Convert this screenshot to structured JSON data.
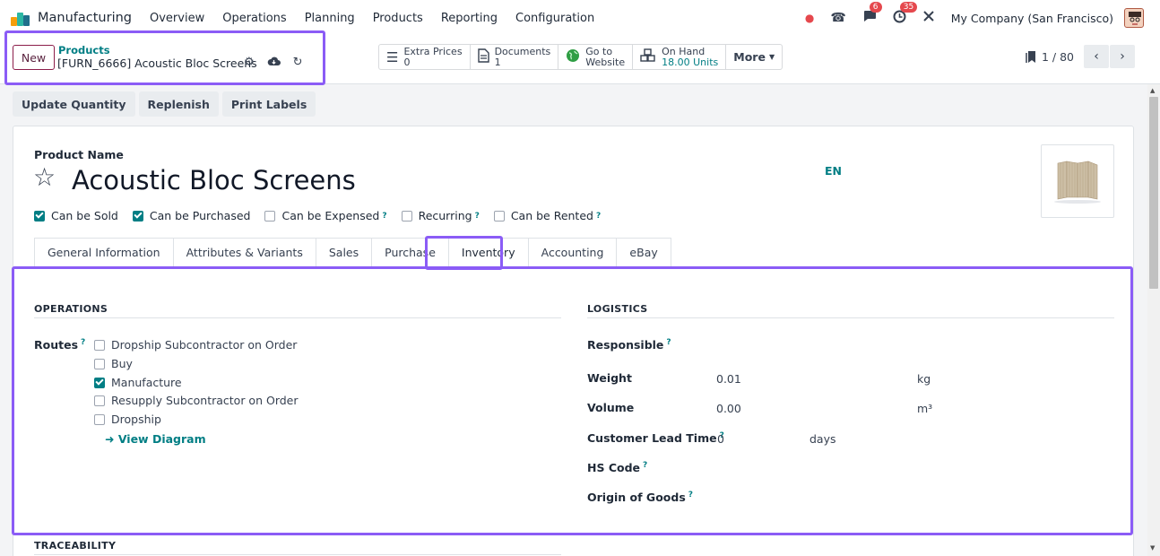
{
  "navbar": {
    "app_name": "Manufacturing",
    "menu": [
      "Overview",
      "Operations",
      "Planning",
      "Products",
      "Reporting",
      "Configuration"
    ],
    "messages_badge": "6",
    "activities_badge": "35",
    "company": "My Company (San Francisco)"
  },
  "control_panel": {
    "new_label": "New",
    "breadcrumb_parent": "Products",
    "breadcrumb_current": "[FURN_6666] Acoustic Bloc Screens",
    "smart_buttons": [
      {
        "label": "Extra Prices",
        "value": "0",
        "icon": "list-icon"
      },
      {
        "label": "Documents",
        "value": "1",
        "icon": "file-icon"
      },
      {
        "label": "Go to",
        "value": "Website",
        "icon": "globe-icon"
      },
      {
        "label": "On Hand",
        "value": "18.00 Units",
        "icon": "cubes-icon"
      }
    ],
    "more_label": "More",
    "pager": "1 / 80"
  },
  "actions": [
    "Update Quantity",
    "Replenish",
    "Print Labels"
  ],
  "form": {
    "product_name_label": "Product Name",
    "product_name": "Acoustic Bloc Screens",
    "lang": "EN",
    "checkboxes": [
      {
        "label": "Can be Sold",
        "checked": true,
        "help": false
      },
      {
        "label": "Can be Purchased",
        "checked": true,
        "help": false
      },
      {
        "label": "Can be Expensed",
        "checked": false,
        "help": true
      },
      {
        "label": "Recurring",
        "checked": false,
        "help": true
      },
      {
        "label": "Can be Rented",
        "checked": false,
        "help": true
      }
    ],
    "tabs": [
      "General Information",
      "Attributes & Variants",
      "Sales",
      "Purchase",
      "Inventory",
      "Accounting",
      "eBay"
    ],
    "active_tab": "Inventory"
  },
  "inventory": {
    "operations_title": "OPERATIONS",
    "routes_label": "Routes",
    "routes": [
      {
        "label": "Dropship Subcontractor on Order",
        "checked": false
      },
      {
        "label": "Buy",
        "checked": false
      },
      {
        "label": "Manufacture",
        "checked": true
      },
      {
        "label": "Resupply Subcontractor on Order",
        "checked": false
      },
      {
        "label": "Dropship",
        "checked": false
      }
    ],
    "view_diagram": "View Diagram",
    "logistics_title": "LOGISTICS",
    "responsible_label": "Responsible",
    "weight_label": "Weight",
    "weight_value": "0.01",
    "weight_unit": "kg",
    "volume_label": "Volume",
    "volume_value": "0.00",
    "volume_unit": "m³",
    "lead_time_label": "Customer Lead Time",
    "lead_time_value": "0",
    "lead_time_unit": "days",
    "hs_code_label": "HS Code",
    "origin_label": "Origin of Goods",
    "traceability_title": "TRACEABILITY"
  },
  "help_glyph": "?",
  "colors": {
    "accent": "#017e84",
    "highlight": "#8b5cf6",
    "badge": "#e5484d"
  }
}
